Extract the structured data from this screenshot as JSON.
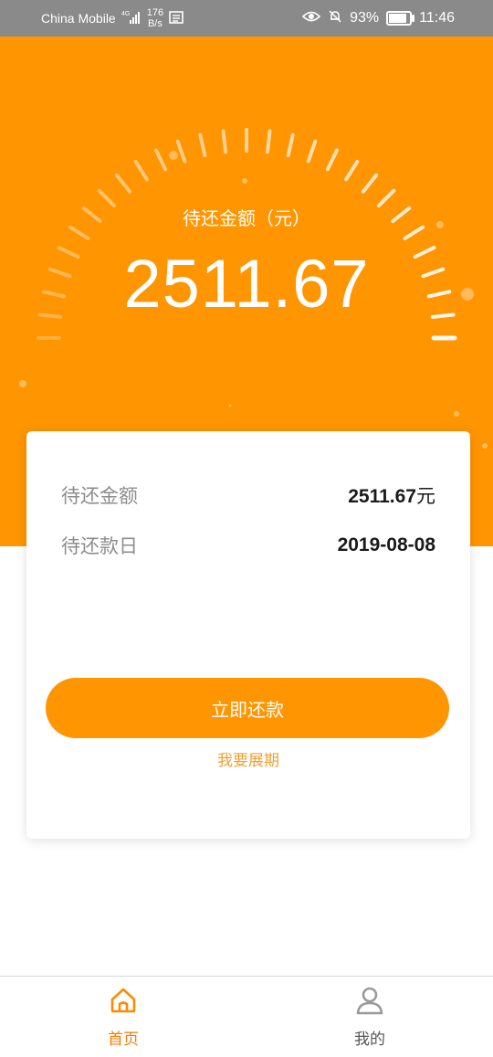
{
  "status_bar": {
    "carrier": "China Mobile",
    "network": "4G",
    "speed_value": "176",
    "speed_unit": "B/s",
    "battery": "93%",
    "battery_level": 0.93,
    "time": "11:46"
  },
  "hero": {
    "label": "待还金额（元）",
    "amount": "2511.67"
  },
  "card": {
    "rows": [
      {
        "label": "待还金额",
        "value": "2511.67",
        "unit": "元"
      },
      {
        "label": "待还款日",
        "value": "2019-08-08",
        "unit": ""
      }
    ],
    "repay_button": "立即还款",
    "extend_link": "我要展期"
  },
  "tabs": [
    {
      "label": "首页",
      "icon": "home-icon",
      "active": true
    },
    {
      "label": "我的",
      "icon": "profile-icon",
      "active": false
    }
  ],
  "colors": {
    "accent": "#ff9500",
    "active_tab": "#ff7a00",
    "status_bar": "#8a8a8a"
  }
}
